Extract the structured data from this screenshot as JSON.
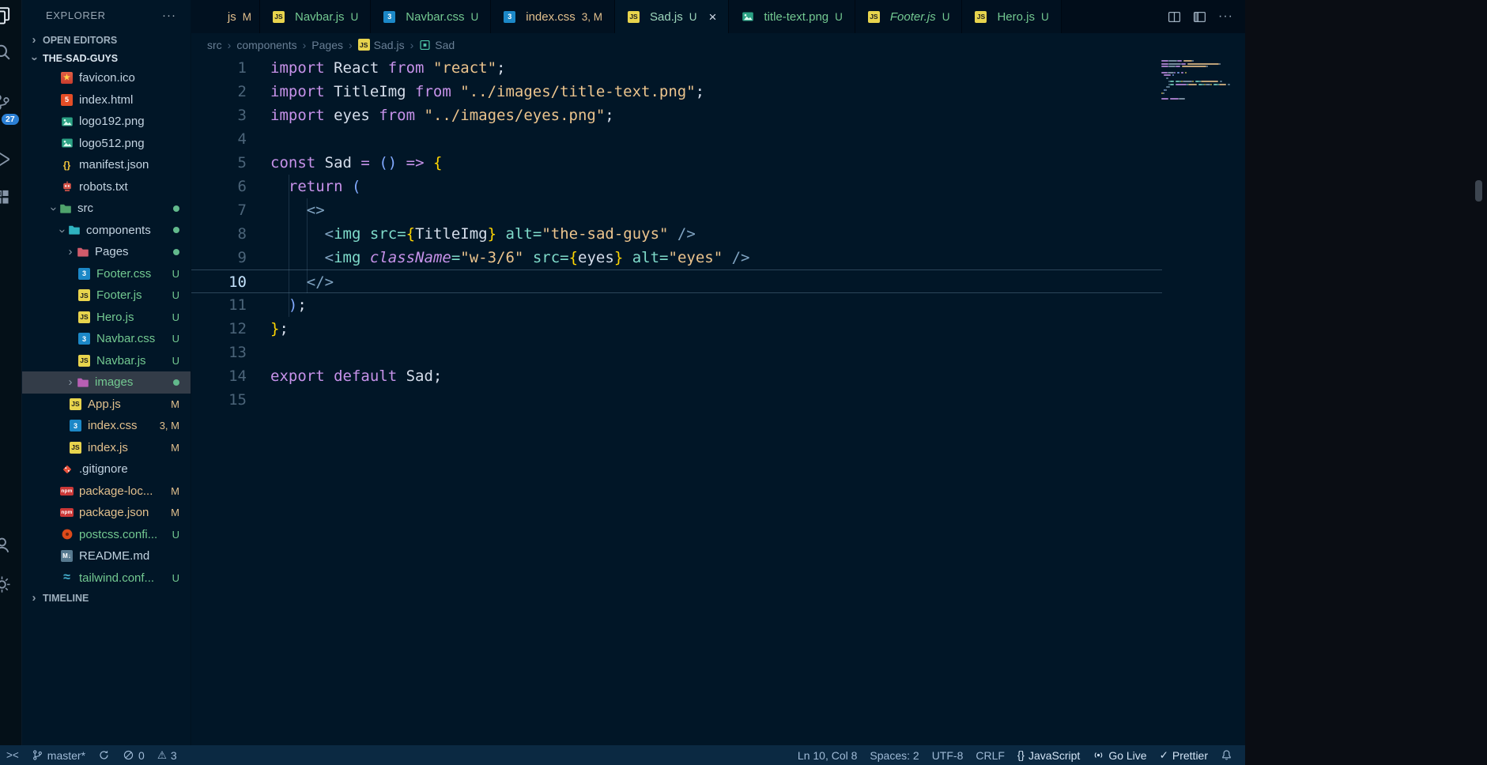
{
  "colors": {
    "editor_bg": "#011627",
    "activity_bg": "#041018",
    "tabbar_bg": "#010d1a",
    "statusbar_bg": "#0b2942",
    "untracked_green": "#73c991",
    "modified_tan": "#e2c08d",
    "keyword_purple": "#c792ea",
    "string_tan": "#ecc48d",
    "badge_blue": "#2b7fd4"
  },
  "activity_bar": {
    "items": [
      {
        "name": "files",
        "active": true
      },
      {
        "name": "search"
      },
      {
        "name": "source-control",
        "badge": "27"
      },
      {
        "name": "run-debug"
      },
      {
        "name": "extensions"
      }
    ],
    "bottom_items": [
      {
        "name": "account"
      },
      {
        "name": "settings"
      }
    ]
  },
  "sidebar": {
    "title": "EXPLORER",
    "more_label": "···",
    "open_editors_label": "OPEN EDITORS",
    "project_label": "THE-SAD-GUYS",
    "timeline_label": "TIMELINE",
    "tree": [
      {
        "label": "favicon.ico",
        "icon": "favicon",
        "level": 0
      },
      {
        "label": "index.html",
        "icon": "html",
        "level": 0
      },
      {
        "label": "logo192.png",
        "icon": "image",
        "level": 0
      },
      {
        "label": "logo512.png",
        "icon": "image",
        "level": 0
      },
      {
        "label": "manifest.json",
        "icon": "json",
        "level": 0
      },
      {
        "label": "robots.txt",
        "icon": "robot",
        "level": 0
      },
      {
        "label": "src",
        "icon": "folder",
        "fcolor": "#4fa36c",
        "level": 0,
        "folder": true,
        "expanded": true,
        "dot": true
      },
      {
        "label": "components",
        "icon": "folder",
        "fcolor": "#2fb3c0",
        "level": 1,
        "folder": true,
        "expanded": true,
        "dot": true
      },
      {
        "label": "Pages",
        "icon": "folder",
        "fcolor": "#d15b6b",
        "level": 2,
        "folder": true,
        "expanded": false,
        "dot": true
      },
      {
        "label": "Footer.css",
        "icon": "css",
        "level": 2,
        "badge": "U",
        "color": "untracked"
      },
      {
        "label": "Footer.js",
        "icon": "js",
        "level": 2,
        "badge": "U",
        "color": "untracked"
      },
      {
        "label": "Hero.js",
        "icon": "js",
        "level": 2,
        "badge": "U",
        "color": "untracked"
      },
      {
        "label": "Navbar.css",
        "icon": "css",
        "level": 2,
        "badge": "U",
        "color": "untracked"
      },
      {
        "label": "Navbar.js",
        "icon": "js",
        "level": 2,
        "badge": "U",
        "color": "untracked"
      },
      {
        "label": "images",
        "icon": "folder",
        "fcolor": "#b75fb3",
        "level": 2,
        "folder": true,
        "expanded": false,
        "dot": true,
        "selected": true,
        "color": "untracked"
      },
      {
        "label": "App.js",
        "icon": "js",
        "level": 1,
        "badge": "M",
        "color": "mod"
      },
      {
        "label": "index.css",
        "icon": "css",
        "level": 1,
        "badge": "3, M",
        "color": "mod"
      },
      {
        "label": "index.js",
        "icon": "js",
        "level": 1,
        "badge": "M",
        "color": "mod"
      },
      {
        "label": ".gitignore",
        "icon": "git",
        "level": 0
      },
      {
        "label": "package-loc...",
        "icon": "npm",
        "level": 0,
        "badge": "M",
        "color": "mod"
      },
      {
        "label": "package.json",
        "icon": "npm",
        "level": 0,
        "badge": "M",
        "color": "mod"
      },
      {
        "label": "postcss.confi...",
        "icon": "postcss",
        "level": 0,
        "badge": "U",
        "color": "untracked"
      },
      {
        "label": "README.md",
        "icon": "md",
        "level": 0
      },
      {
        "label": "tailwind.conf...",
        "icon": "tailwind",
        "level": 0,
        "badge": "U",
        "color": "untracked"
      }
    ]
  },
  "tabbar": {
    "tabs": [
      {
        "id": "app-js-partial",
        "label": "js",
        "status": "M",
        "color": "mod",
        "partial": true
      },
      {
        "id": "navbar-js",
        "label": "Navbar.js",
        "status": "U",
        "icon": "js",
        "color": "untracked"
      },
      {
        "id": "navbar-css",
        "label": "Navbar.css",
        "status": "U",
        "icon": "css",
        "color": "untracked"
      },
      {
        "id": "index-css",
        "label": "index.css",
        "status": "3, M",
        "icon": "css",
        "color": "mod"
      },
      {
        "id": "sad-js",
        "label": "Sad.js",
        "status": "U",
        "icon": "js",
        "color": "active",
        "active": true,
        "close": "×"
      },
      {
        "id": "title-text-png",
        "label": "title-text.png",
        "status": "U",
        "icon": "image",
        "color": "untracked"
      },
      {
        "id": "footer-js",
        "label": "Footer.js",
        "status": "U",
        "icon": "js",
        "color": "untracked",
        "italic": true
      },
      {
        "id": "hero-js",
        "label": "Hero.js",
        "status": "U",
        "icon": "js",
        "color": "untracked"
      }
    ],
    "actions": [
      {
        "name": "split-editor"
      },
      {
        "name": "layout"
      },
      {
        "name": "more-actions",
        "label": "···"
      }
    ]
  },
  "breadcrumb": {
    "items": [
      {
        "label": "src"
      },
      {
        "label": "components"
      },
      {
        "label": "Pages"
      },
      {
        "label": "Sad.js",
        "icon": "js"
      },
      {
        "label": "Sad",
        "icon": "symbol"
      }
    ]
  },
  "editor": {
    "current_line": 10,
    "lines": [
      {
        "num": 1,
        "tokens": [
          [
            "kw",
            "import"
          ],
          [
            "fg",
            " React "
          ],
          [
            "kw",
            "from"
          ],
          [
            "fg",
            " "
          ],
          [
            "str",
            "\"react\""
          ],
          [
            "fg",
            ";"
          ]
        ]
      },
      {
        "num": 2,
        "tokens": [
          [
            "kw",
            "import"
          ],
          [
            "fg",
            " TitleImg "
          ],
          [
            "kw",
            "from"
          ],
          [
            "fg",
            " "
          ],
          [
            "str",
            "\"../images/title-text.png\""
          ],
          [
            "fg",
            ";"
          ]
        ]
      },
      {
        "num": 3,
        "tokens": [
          [
            "kw",
            "import"
          ],
          [
            "fg",
            " eyes "
          ],
          [
            "kw",
            "from"
          ],
          [
            "fg",
            " "
          ],
          [
            "str",
            "\"../images/eyes.png\""
          ],
          [
            "fg",
            ";"
          ]
        ]
      },
      {
        "num": 4,
        "tokens": []
      },
      {
        "num": 5,
        "tokens": [
          [
            "kw",
            "const"
          ],
          [
            "fg",
            " Sad "
          ],
          [
            "op",
            "="
          ],
          [
            "fg",
            " "
          ],
          [
            "paren",
            "()"
          ],
          [
            "fg",
            " "
          ],
          [
            "op",
            "=>"
          ],
          [
            "fg",
            " "
          ],
          [
            "brace",
            "{"
          ]
        ]
      },
      {
        "num": 6,
        "tokens": [
          [
            "fg",
            "  "
          ],
          [
            "kw",
            "return"
          ],
          [
            "fg",
            " "
          ],
          [
            "paren",
            "("
          ]
        ]
      },
      {
        "num": 7,
        "tokens": [
          [
            "fg",
            "    "
          ],
          [
            "tagb",
            "<>"
          ]
        ]
      },
      {
        "num": 8,
        "tokens": [
          [
            "fg",
            "      "
          ],
          [
            "tagb",
            "<"
          ],
          [
            "tag",
            "img"
          ],
          [
            "fg",
            " "
          ],
          [
            "attr",
            "src"
          ],
          [
            "opa",
            "="
          ],
          [
            "brace",
            "{"
          ],
          [
            "fg",
            "TitleImg"
          ],
          [
            "brace",
            "}"
          ],
          [
            "fg",
            " "
          ],
          [
            "attr",
            "alt"
          ],
          [
            "opa",
            "="
          ],
          [
            "str",
            "\"the-sad-guys\""
          ],
          [
            "fg",
            " "
          ],
          [
            "tagb",
            "/>"
          ]
        ]
      },
      {
        "num": 9,
        "tokens": [
          [
            "fg",
            "      "
          ],
          [
            "tagb",
            "<"
          ],
          [
            "tag",
            "img"
          ],
          [
            "fg",
            " "
          ],
          [
            "attri",
            "className"
          ],
          [
            "opa",
            "="
          ],
          [
            "str",
            "\"w-3/6\""
          ],
          [
            "fg",
            " "
          ],
          [
            "attr",
            "src"
          ],
          [
            "opa",
            "="
          ],
          [
            "brace",
            "{"
          ],
          [
            "fg",
            "eyes"
          ],
          [
            "brace",
            "}"
          ],
          [
            "fg",
            " "
          ],
          [
            "attr",
            "alt"
          ],
          [
            "opa",
            "="
          ],
          [
            "str",
            "\"eyes\""
          ],
          [
            "fg",
            " "
          ],
          [
            "tagb",
            "/>"
          ]
        ]
      },
      {
        "num": 10,
        "tokens": [
          [
            "fg",
            "    "
          ],
          [
            "tagb",
            "</>"
          ]
        ]
      },
      {
        "num": 11,
        "tokens": [
          [
            "fg",
            "  "
          ],
          [
            "paren",
            ")"
          ],
          [
            "fg",
            ";"
          ]
        ]
      },
      {
        "num": 12,
        "tokens": [
          [
            "brace",
            "}"
          ],
          [
            "fg",
            ";"
          ]
        ]
      },
      {
        "num": 13,
        "tokens": []
      },
      {
        "num": 14,
        "tokens": [
          [
            "kw",
            "export"
          ],
          [
            "fg",
            " "
          ],
          [
            "kw",
            "default"
          ],
          [
            "fg",
            " Sad;"
          ]
        ]
      },
      {
        "num": 15,
        "tokens": []
      }
    ]
  },
  "statusbar": {
    "left": [
      {
        "name": "remote-indicator",
        "icon": "remote"
      },
      {
        "name": "git-branch",
        "icon": "branch",
        "label": "master*"
      },
      {
        "name": "sync-changes",
        "icon": "sync"
      },
      {
        "name": "errors",
        "icon": "error",
        "label": "0"
      },
      {
        "name": "warnings",
        "icon": "warning",
        "label": "3"
      }
    ],
    "right": [
      {
        "name": "cursor-position",
        "label": "Ln 10, Col 8"
      },
      {
        "name": "indentation",
        "label": "Spaces: 2"
      },
      {
        "name": "encoding",
        "label": "UTF-8"
      },
      {
        "name": "eol",
        "label": "CRLF"
      },
      {
        "name": "language-mode",
        "icon": "braces",
        "label": "JavaScript",
        "bright": true
      },
      {
        "name": "go-live",
        "icon": "golive",
        "label": "Go Live",
        "bright": true
      },
      {
        "name": "prettier",
        "icon": "check",
        "label": "Prettier",
        "bright": true
      },
      {
        "name": "notifications",
        "icon": "bell"
      }
    ]
  }
}
